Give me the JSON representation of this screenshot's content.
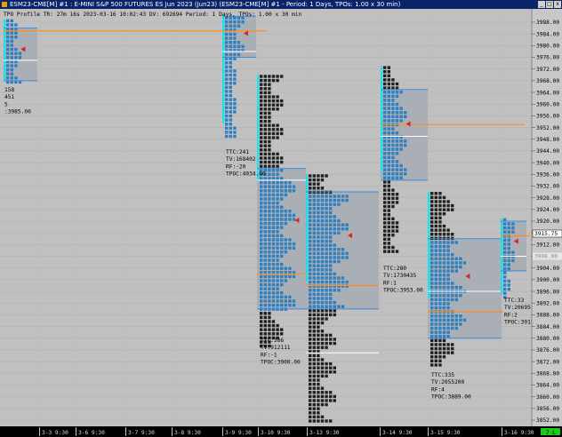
{
  "window": {
    "title": "ESM23-CME[M] #1 : E-MINI S&P 500 FUTURES ES Jun 2023 (Jun23) (ESM23-CME[M] #1 - Period: 1 Days, TPOs: 1.00 x 30 min)",
    "min_glyph": "_",
    "max_glyph": "□",
    "close_glyph": "x"
  },
  "study_header": "TPO Profile TR: 27m 16s 2023-03-16 10:02:43 DV: 692694 Period: 1 Days, TPOs: 1.00 x 30 min",
  "price_axis": {
    "min": 3850,
    "max": 3990,
    "ticks": [
      3988,
      3984,
      3980,
      3976,
      3972,
      3968,
      3964,
      3960,
      3956,
      3952,
      3948,
      3944,
      3940,
      3936,
      3932,
      3928,
      3924,
      3920,
      3916,
      3912,
      3908,
      3904,
      3900,
      3896,
      3892,
      3888,
      3884,
      3880,
      3876,
      3872,
      3868,
      3864,
      3860,
      3856,
      3852
    ],
    "last_price": "3915.75",
    "alt_price": "3908.00"
  },
  "date_axis": [
    {
      "label": "3-3  9:30"
    },
    {
      "label": "3-6  9:30"
    },
    {
      "label": "3-7  9:30"
    },
    {
      "label": "3-8  9:30"
    },
    {
      "label": "3-9  9:30"
    },
    {
      "label": "3-10  9:30"
    },
    {
      "label": "3-13  9:30"
    },
    {
      "label": "3-14  9:30"
    },
    {
      "label": "3-15  9:30"
    },
    {
      "label": "3-16  9:30"
    }
  ],
  "scroll_label": "7 L",
  "colors": {
    "background": "#c0c0c0",
    "grid": "#b2b2b2",
    "value_area": "#a6acb4",
    "tpo_dark": "#202020",
    "tpo_blue": "#2d7fc0",
    "ib_cyan": "#1ee0e8",
    "poc": "#ff8c1a",
    "vah_val": "#3a8be0",
    "single_print": "#e02020"
  },
  "profiles": [
    {
      "day": "3-3",
      "high": 3989,
      "low": 3968,
      "va_high": 3986,
      "va_low": 3968,
      "poc": 3985,
      "mid": 3975,
      "stats": [
        "158",
        "451",
        "5",
        ":3985.00"
      ]
    },
    {
      "day": "3-9",
      "high": 3990,
      "low": 3950,
      "va_high": 3990,
      "va_low": 3976,
      "poc": 3985,
      "mid": 3978,
      "stats": [
        "TTC:241",
        "TV:168402",
        "RF:-20",
        "TPOC:4034.00"
      ]
    },
    {
      "day": "3-10",
      "high": 3970,
      "low": 3878,
      "va_high": 3938,
      "va_low": 3890,
      "poc": 3902,
      "mid": 3934,
      "stats": [
        "TTC:386",
        "TV:912111",
        "RF:-1",
        "TPOC:3900.00"
      ]
    },
    {
      "day": "3-13",
      "high": 3936,
      "low": 3852,
      "va_high": 3930,
      "va_low": 3890,
      "poc": 3898,
      "mid": 3875,
      "stats": []
    },
    {
      "day": "3-14",
      "high": 3973,
      "low": 3910,
      "va_high": 3965,
      "va_low": 3934,
      "poc": 3953,
      "mid": 3949,
      "stats": [
        "TTC:280",
        "TV:1730435",
        "RF:1",
        "TPOC:3953.00"
      ]
    },
    {
      "day": "3-15",
      "high": 3930,
      "low": 3872,
      "va_high": 3914,
      "va_low": 3880,
      "poc": 3889,
      "mid": 3896,
      "stats": [
        "TTC:335",
        "TV:2055200",
        "RF:4",
        "TPOC:3889.00"
      ]
    },
    {
      "day": "3-16",
      "high": 3921,
      "low": 3895,
      "va_high": 3920,
      "va_low": 3903,
      "poc": 3915,
      "mid": 3908,
      "stats": [
        "TTC:33",
        "TV:206951",
        "RF:2",
        "TPOC:3915.00"
      ]
    }
  ]
}
